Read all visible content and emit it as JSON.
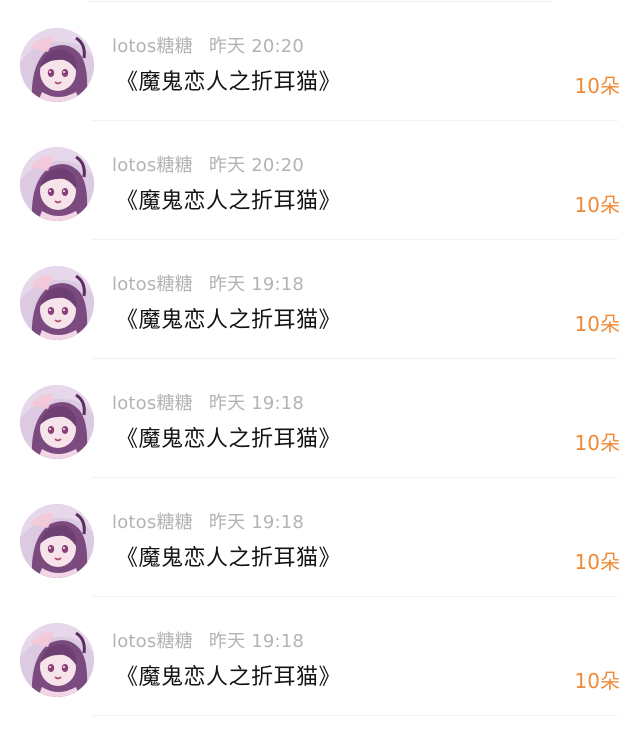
{
  "gifts": [
    {
      "user": "lotos糖糖",
      "time": "昨天 20:20",
      "title": "《魔鬼恋人之折耳猫》",
      "amount": "10朵",
      "avatar_icon": "anime-girl-avatar-icon"
    },
    {
      "user": "lotos糖糖",
      "time": "昨天 20:20",
      "title": "《魔鬼恋人之折耳猫》",
      "amount": "10朵",
      "avatar_icon": "anime-girl-avatar-icon"
    },
    {
      "user": "lotos糖糖",
      "time": "昨天 19:18",
      "title": "《魔鬼恋人之折耳猫》",
      "amount": "10朵",
      "avatar_icon": "anime-girl-avatar-icon"
    },
    {
      "user": "lotos糖糖",
      "time": "昨天 19:18",
      "title": "《魔鬼恋人之折耳猫》",
      "amount": "10朵",
      "avatar_icon": "anime-girl-avatar-icon"
    },
    {
      "user": "lotos糖糖",
      "time": "昨天 19:18",
      "title": "《魔鬼恋人之折耳猫》",
      "amount": "10朵",
      "avatar_icon": "anime-girl-avatar-icon"
    },
    {
      "user": "lotos糖糖",
      "time": "昨天 19:18",
      "title": "《魔鬼恋人之折耳猫》",
      "amount": "10朵",
      "avatar_icon": "anime-girl-avatar-icon"
    }
  ],
  "colors": {
    "amount": "#f08a36",
    "title": "#141414",
    "meta": "#b3b3b3",
    "divider": "#f1f1f1"
  }
}
